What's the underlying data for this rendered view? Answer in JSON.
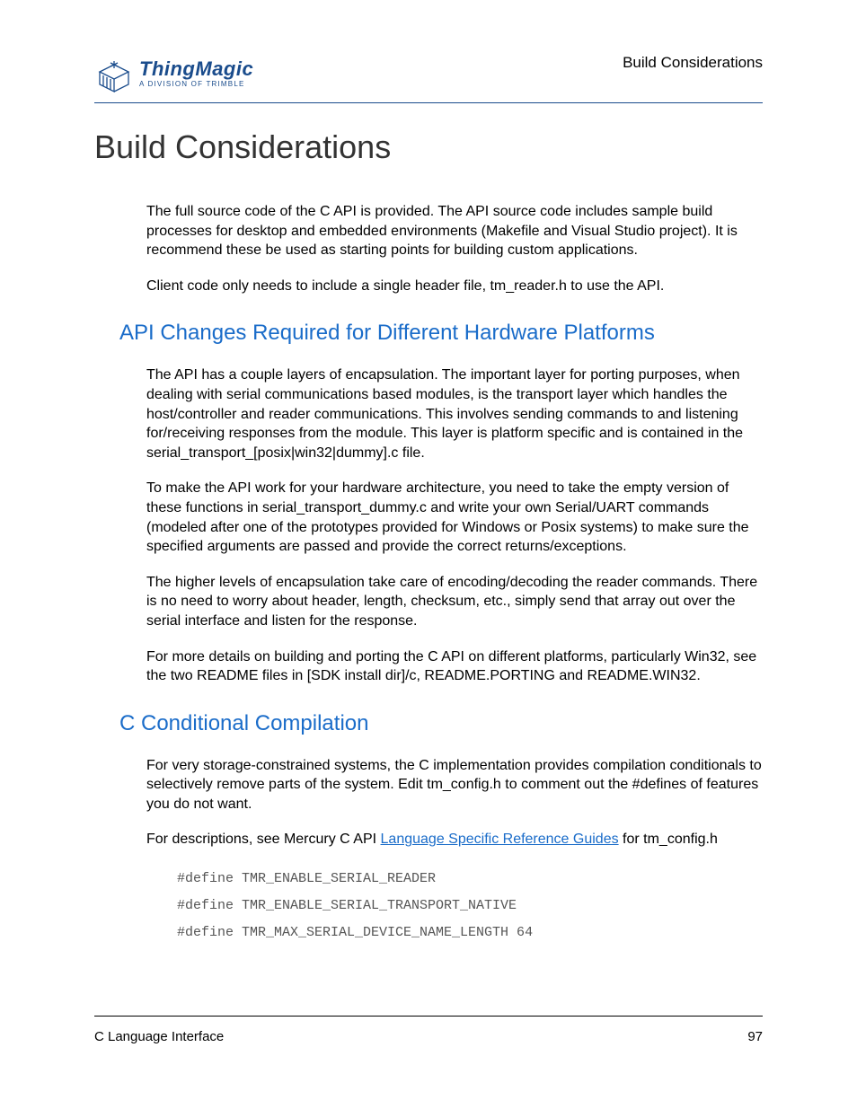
{
  "header": {
    "running_title": "Build Considerations",
    "logo_main": "ThingMagic",
    "logo_sub": "A DIVISION OF TRIMBLE"
  },
  "title": "Build Considerations",
  "intro": {
    "p1": "The full source code of the C API is provided. The API source code includes sample build processes for desktop and embedded environments (Makefile and Visual Studio project). It is recommend these be used as starting points for building custom applications.",
    "p2": "Client code only needs to include a single header file, tm_reader.h to use the API."
  },
  "section1": {
    "heading": "API Changes Required for Different Hardware Platforms",
    "p1": "The API has a couple layers of encapsulation. The important layer for porting purposes, when dealing with serial communications based modules, is the transport layer which handles the host/controller and reader communications. This involves sending commands to and listening for/receiving responses from the module. This layer is platform specific and is contained in the serial_transport_[posix|win32|dummy].c file.",
    "p2": "To make the API work for your hardware architecture, you need to take the empty version of these functions in serial_transport_dummy.c and write your own Serial/UART commands (modeled after one of the prototypes provided for Windows or Posix systems) to make sure the specified arguments are passed and provide the correct returns/exceptions.",
    "p3": "The higher levels of encapsulation take care of encoding/decoding the reader commands. There is no need to worry about header, length, checksum, etc., simply send that array out over the serial interface and listen for the response.",
    "p4": "For more details on building and porting the C API on different platforms, particularly Win32, see the two README files in [SDK install dir]/c, README.PORTING and README.WIN32."
  },
  "section2": {
    "heading": "C Conditional Compilation",
    "p1": "For very storage-constrained systems, the C implementation provides compilation conditionals to selectively remove parts of the system.  Edit tm_config.h to comment out the #defines of features you do not want.",
    "p2_pre": "For descriptions, see Mercury C API ",
    "p2_link": "Language Specific Reference Guides",
    "p2_post": " for tm_config.h",
    "code1": "#define TMR_ENABLE_SERIAL_READER",
    "code2": "#define TMR_ENABLE_SERIAL_TRANSPORT_NATIVE",
    "code3": "#define TMR_MAX_SERIAL_DEVICE_NAME_LENGTH 64"
  },
  "footer": {
    "left": "C Language Interface",
    "right": "97"
  }
}
